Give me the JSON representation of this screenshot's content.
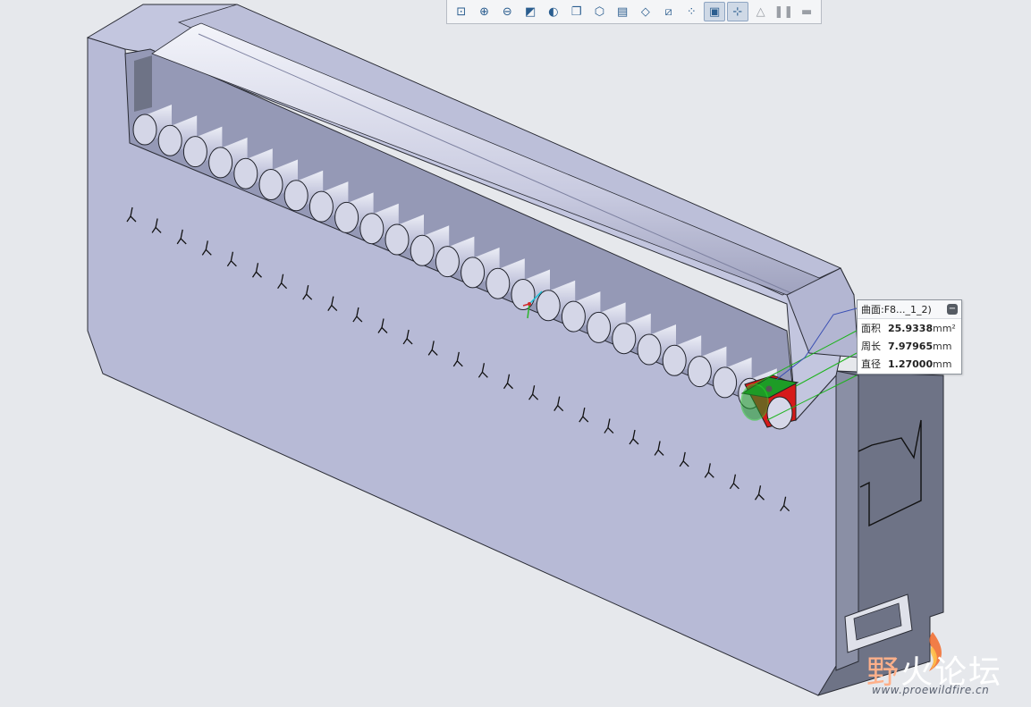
{
  "toolbar": {
    "buttons": [
      {
        "name": "refit-button",
        "glyph": "⊡"
      },
      {
        "name": "zoom-in-button",
        "glyph": "⊕"
      },
      {
        "name": "zoom-out-button",
        "glyph": "⊖"
      },
      {
        "name": "repaint-button",
        "glyph": "◩"
      },
      {
        "name": "display-style-button",
        "glyph": "◐"
      },
      {
        "name": "saved-views-button",
        "glyph": "❐"
      },
      {
        "name": "view-manager-button",
        "glyph": "⬡"
      },
      {
        "name": "appearance-button",
        "glyph": "▤"
      },
      {
        "name": "perspective-button",
        "glyph": "◇"
      },
      {
        "name": "section-button",
        "glyph": "⧄"
      },
      {
        "name": "datum-display-button",
        "glyph": "⁘"
      },
      {
        "name": "annotation-display-button",
        "glyph": "▣"
      },
      {
        "name": "spin-center-button",
        "glyph": "⊹"
      },
      {
        "name": "warning-button",
        "glyph": "△"
      },
      {
        "name": "pause-button",
        "glyph": "❚❚"
      },
      {
        "name": "regenerate-button",
        "glyph": "▬"
      }
    ]
  },
  "info_panel": {
    "title": "曲面:F8..._1_2)",
    "collapse": "−",
    "rows": [
      {
        "label": "面积",
        "value": "25.9338",
        "unit": "mm²"
      },
      {
        "label": "周长",
        "value": "7.97965",
        "unit": "mm"
      },
      {
        "label": "直径",
        "value": "1.27000",
        "unit": "mm"
      }
    ]
  },
  "watermark": {
    "title_a": "野",
    "title_b": "火论坛",
    "url": "www.proewildfire.cn"
  },
  "colors": {
    "background": "#e6e8ec",
    "model_face": "#b7bad6",
    "model_top": "#c3c6df",
    "model_dark": "#6e7386",
    "highlight_green": "#1d9c26",
    "highlight_red": "#d61a1a",
    "measure_line": "#1db31d"
  }
}
